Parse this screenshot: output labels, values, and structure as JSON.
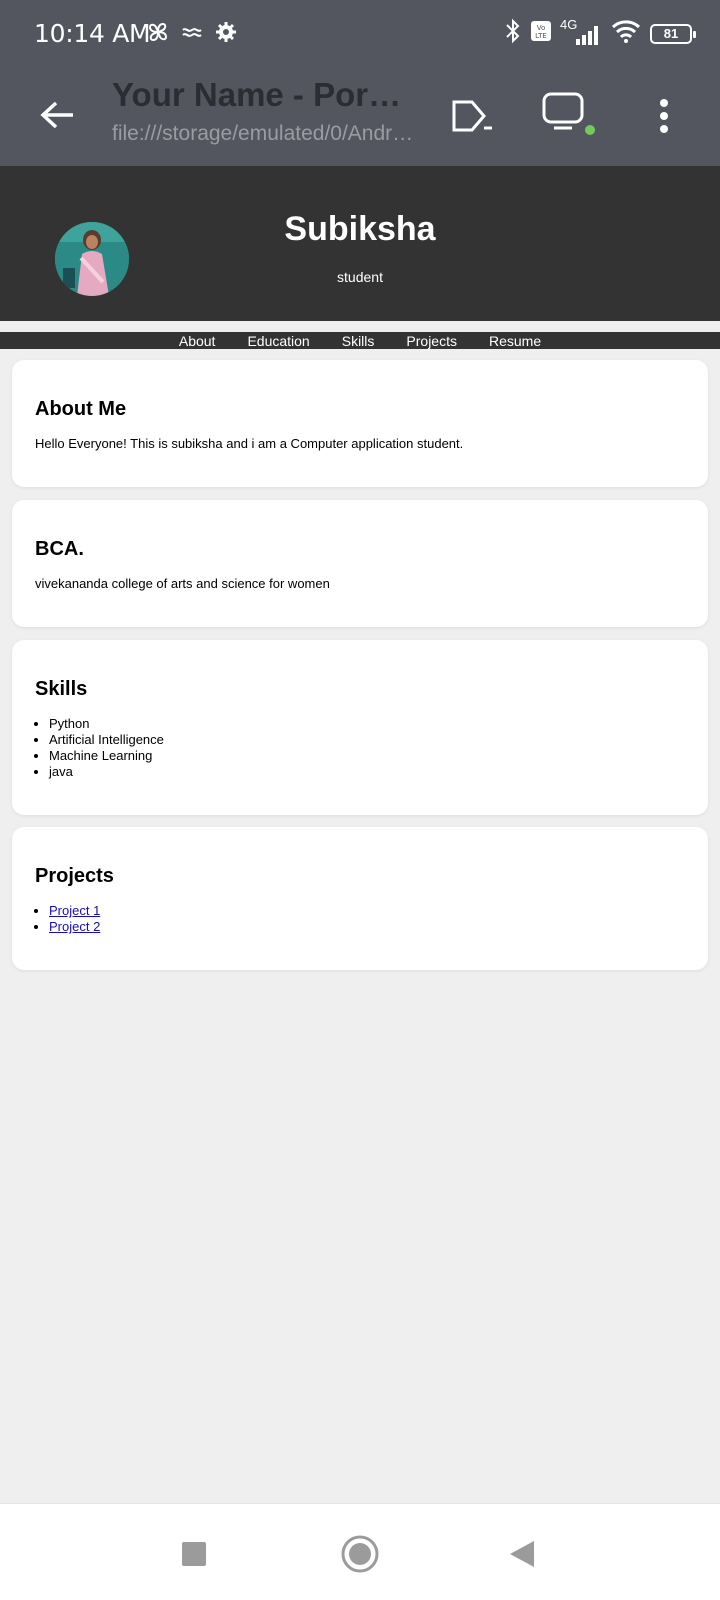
{
  "status_bar": {
    "time": "10:14 AM",
    "network": "4G",
    "battery": "81"
  },
  "browser": {
    "title": "Your Name - Portfolio",
    "url": "file:///storage/emulated/0/Android/data/portfolio.html"
  },
  "header": {
    "name": "Subiksha",
    "tagline": "student"
  },
  "nav": [
    {
      "label": "About"
    },
    {
      "label": "Education"
    },
    {
      "label": "Skills"
    },
    {
      "label": "Projects"
    },
    {
      "label": "Resume"
    }
  ],
  "sections": {
    "about": {
      "heading": "About Me",
      "text": "Hello Everyone! This is subiksha and i am a Computer application student."
    },
    "education": {
      "heading": "BCA.",
      "text": "vivekananda college of arts and science for women"
    },
    "skills": {
      "heading": "Skills",
      "items": [
        "Python",
        "Artificial Intelligence",
        "Machine Learning",
        "java"
      ]
    },
    "projects": {
      "heading": "Projects",
      "items": [
        "Project 1",
        "Project 2"
      ]
    }
  },
  "colors": {
    "header_bg": "#333333",
    "toolbar_bg": "#53565f",
    "page_bg": "#efefef",
    "link": "#1a0dab"
  }
}
